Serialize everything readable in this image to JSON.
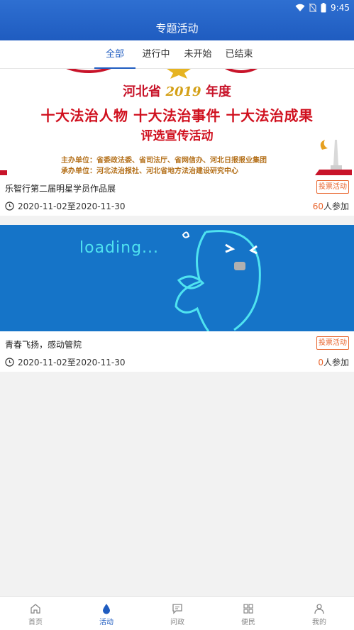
{
  "status": {
    "time": "9:45"
  },
  "header": {
    "title": "专题活动"
  },
  "tabs": [
    {
      "label": "全部",
      "active": true
    },
    {
      "label": "进行中",
      "active": false
    },
    {
      "label": "未开始",
      "active": false
    },
    {
      "label": "已结束",
      "active": false
    }
  ],
  "banner1": {
    "province": "河北省",
    "year": "2019",
    "year_suffix": "年度",
    "line1": "十大法治人物 十大法治事件 十大法治成果",
    "line2": "评选宣传活动",
    "organizer": "主办单位：省委政法委、省司法厅、省网信办、河北日报报业集团",
    "co_organizer": "承办单位：河北法治报社、河北省地方法治建设研究中心"
  },
  "banner2": {
    "loading": "loading..."
  },
  "activities": [
    {
      "title": "乐智行第二届明星学员作品展",
      "badge": "投票活动",
      "date": "2020-11-02至2020-11-30",
      "count": "60",
      "count_suffix": "人参加"
    },
    {
      "title": "青春飞扬，感动管院",
      "badge": "投票活动",
      "date": "2020-11-02至2020-11-30",
      "count": "0",
      "count_suffix": "人参加"
    }
  ],
  "tabbar": [
    {
      "label": "首页",
      "icon": "home-icon",
      "active": false
    },
    {
      "label": "活动",
      "icon": "drop-icon",
      "active": true
    },
    {
      "label": "问政",
      "icon": "message-icon",
      "active": false
    },
    {
      "label": "便民",
      "icon": "grid-icon",
      "active": false
    },
    {
      "label": "我的",
      "icon": "user-icon",
      "active": false
    }
  ],
  "colors": {
    "primary": "#1f5cc0",
    "accent": "#e8642c",
    "banner_red": "#d0111f",
    "banner2_bg": "#1574c8"
  }
}
